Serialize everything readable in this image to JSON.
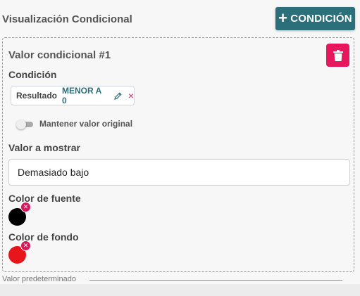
{
  "header": {
    "title": "Visualización Condicional",
    "add_button_label": "CONDICIÓN"
  },
  "card": {
    "title": "Valor condicional #1",
    "condition_label": "Condición",
    "condition_chip": {
      "field": "Resultado",
      "operator": "MENOR A 0"
    },
    "toggle": {
      "label": "Mantener valor original",
      "checked": false
    },
    "value_label": "Valor a mostrar",
    "value_input": "Demasiado bajo",
    "font_color_label": "Color de fuente",
    "font_color": "#000000",
    "bg_color_label": "Color de fondo",
    "bg_color": "#e8151b"
  },
  "footer": {
    "default_label": "Valor predeterminado"
  },
  "colors": {
    "primary": "#2a6f7a",
    "danger": "#e8175d"
  }
}
